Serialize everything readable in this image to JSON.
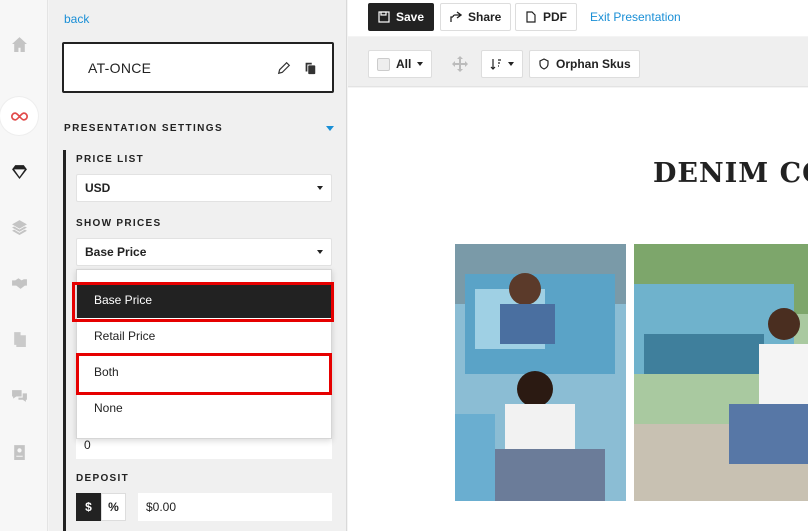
{
  "sidebar_rail": {
    "items": [
      {
        "icon": "home-icon"
      },
      {
        "icon": "infinity-logo-icon"
      },
      {
        "icon": "diamond-icon"
      },
      {
        "icon": "layers-icon"
      },
      {
        "icon": "handshake-icon"
      },
      {
        "icon": "documents-icon"
      },
      {
        "icon": "chat-icon"
      },
      {
        "icon": "contact-card-icon"
      }
    ],
    "accent": "#e24b4b"
  },
  "panel": {
    "back_label": "back",
    "presentation_name": "AT-ONCE",
    "section_title": "PRESENTATION SETTINGS",
    "price_list": {
      "label": "PRICE LIST",
      "value": "USD"
    },
    "show_prices": {
      "label": "SHOW PRICES",
      "value": "Base Price",
      "options": [
        "Base Price",
        "Retail Price",
        "Both",
        "None"
      ]
    },
    "hidden_field_value": "0",
    "deposit": {
      "label": "DEPOSIT",
      "dollar": "$",
      "percent": "%",
      "value": "$0.00"
    }
  },
  "toolbar": {
    "save": "Save",
    "share": "Share",
    "pdf": "PDF",
    "exit": "Exit Presentation"
  },
  "subtoolbar": {
    "all": "All",
    "orphan": "Orphan Skus"
  },
  "canvas": {
    "title": "DENIM CO"
  },
  "colors": {
    "link": "#1a8fd6",
    "highlight": "#e60000",
    "dark": "#222222"
  }
}
